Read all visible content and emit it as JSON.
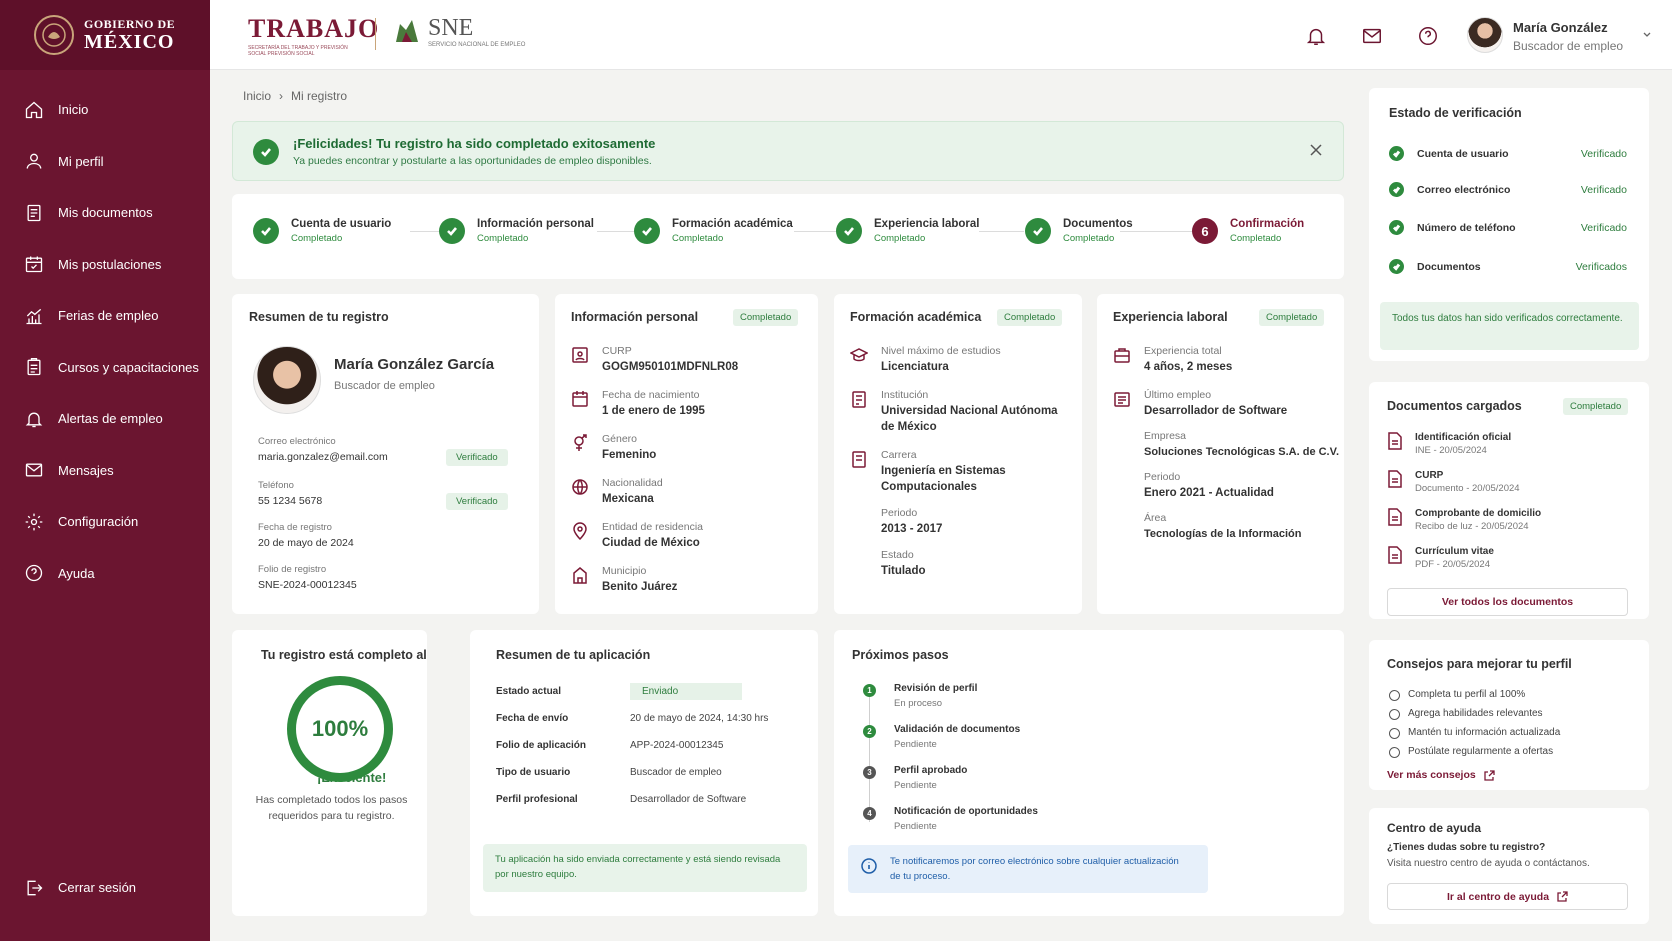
{
  "sidebar": {
    "gob_top": "GOBIERNO DE",
    "gob_main": "MÉXICO",
    "items": [
      {
        "label": "Inicio",
        "icon": "home-icon"
      },
      {
        "label": "Mi perfil",
        "icon": "user-icon"
      },
      {
        "label": "Mis documentos",
        "icon": "document-icon"
      },
      {
        "label": "Mis postulaciones",
        "icon": "calendar-check-icon"
      },
      {
        "label": "Ferias de empleo",
        "icon": "chart-icon"
      },
      {
        "label": "Cursos y capacitaciones",
        "icon": "clipboard-icon"
      },
      {
        "label": "Alertas de empleo",
        "icon": "bell-icon"
      },
      {
        "label": "Mensajes",
        "icon": "mail-icon"
      },
      {
        "label": "Configuración",
        "icon": "gear-icon"
      },
      {
        "label": "Ayuda",
        "icon": "help-icon"
      }
    ],
    "logout": "Cerrar sesión"
  },
  "topbar": {
    "trabajo": "TRABAJO",
    "trabajo_sub": "SECRETARÍA DEL TRABAJO Y PREVISIÓN SOCIAL PREVISIÓN SOCIAL",
    "sne": "SNE",
    "sne_sub": "SERVICIO NACIONAL DE EMPLEO",
    "user_name": "María González",
    "user_role": "Buscador de empleo"
  },
  "breadcrumb": {
    "home": "Inicio",
    "sep": "›",
    "current": "Mi registro"
  },
  "alert": {
    "title": "¡Felicidades! Tu registro ha sido completado exitosamente",
    "text": "Ya puedes encontrar y postularte a las oportunidades de empleo disponibles."
  },
  "steps": [
    {
      "label": "Cuenta de usuario",
      "status": "Completado"
    },
    {
      "label": "Información personal",
      "status": "Completado"
    },
    {
      "label": "Formación académica",
      "status": "Completado"
    },
    {
      "label": "Experiencia laboral",
      "status": "Completado"
    },
    {
      "label": "Documentos",
      "status": "Completado"
    },
    {
      "label": "Confirmación",
      "status": "Completado",
      "num": "6"
    }
  ],
  "resumen": {
    "title": "Resumen de tu registro",
    "name": "María González García",
    "role": "Buscador de empleo",
    "email_label": "Correo electrónico",
    "email": "maria.gonzalez@email.com",
    "email_badge": "Verificado",
    "phone_label": "Teléfono",
    "phone": "55 1234 5678",
    "phone_badge": "Verificado",
    "date_label": "Fecha de registro",
    "date": "20 de mayo de 2024",
    "folio_label": "Folio de registro",
    "folio": "SNE-2024-00012345"
  },
  "personal": {
    "title": "Información personal",
    "badge": "Completado",
    "fields": [
      {
        "label": "CURP",
        "value": "GOGM950101MDFNLR08"
      },
      {
        "label": "Fecha de nacimiento",
        "value": "1 de enero de 1995"
      },
      {
        "label": "Género",
        "value": "Femenino"
      },
      {
        "label": "Nacionalidad",
        "value": "Mexicana"
      },
      {
        "label": "Entidad de residencia",
        "value": "Ciudad de México"
      },
      {
        "label": "Municipio",
        "value": "Benito Juárez"
      }
    ]
  },
  "academica": {
    "title": "Formación académica",
    "badge": "Completado",
    "nivel_label": "Nivel máximo de estudios",
    "nivel": "Licenciatura",
    "inst_label": "Institución",
    "inst": "Universidad Nacional Autónoma de México",
    "carrera_label": "Carrera",
    "carrera": "Ingeniería en Sistemas Computacionales",
    "periodo_label": "Periodo",
    "periodo": "2013 - 2017",
    "estado_label": "Estado",
    "estado": "Titulado"
  },
  "experiencia": {
    "title": "Experiencia laboral",
    "badge": "Completado",
    "total_label": "Experiencia total",
    "total": "4 años, 2 meses",
    "ultimo_label": "Último empleo",
    "ultimo": "Desarrollador de Software",
    "empresa_label": "Empresa",
    "empresa": "Soluciones Tecnológicas S.A. de C.V.",
    "periodo_label": "Periodo",
    "periodo": "Enero 2021 - Actualidad",
    "area_label": "Área",
    "area": "Tecnologías de la Información"
  },
  "completo": {
    "title": "Tu registro está completo al",
    "percent": "100%",
    "progress": 1.0,
    "excellent": "¡Excelente!",
    "text": "Has completado todos los pasos requeridos para tu registro."
  },
  "aplicacion": {
    "title": "Resumen de tu aplicación",
    "rows": [
      {
        "label": "Estado actual",
        "value": "Enviado"
      },
      {
        "label": "Fecha de envío",
        "value": "20 de mayo de 2024, 14:30 hrs"
      },
      {
        "label": "Folio de aplicación",
        "value": "APP-2024-00012345"
      },
      {
        "label": "Tipo de usuario",
        "value": "Buscador de empleo"
      },
      {
        "label": "Perfil profesional",
        "value": "Desarrollador de Software"
      }
    ],
    "note": "Tu aplicación ha sido enviada correctamente y está siendo revisada por nuestro equipo."
  },
  "pasos": {
    "title": "Próximos pasos",
    "items": [
      {
        "num": "1",
        "title": "Revisión de perfil",
        "status": "En proceso"
      },
      {
        "num": "2",
        "title": "Validación de documentos",
        "status": "Pendiente"
      },
      {
        "num": "3",
        "title": "Perfil aprobado",
        "status": "Pendiente"
      },
      {
        "num": "4",
        "title": "Notificación de oportunidades",
        "status": "Pendiente"
      }
    ],
    "note": "Te notificaremos por correo electrónico sobre cualquier actualización de tu proceso."
  },
  "verificacion": {
    "title": "Estado de verificación",
    "rows": [
      {
        "label": "Cuenta de usuario",
        "value": "Verificado"
      },
      {
        "label": "Correo electrónico",
        "value": "Verificado"
      },
      {
        "label": "Número de teléfono",
        "value": "Verificado"
      },
      {
        "label": "Documentos",
        "value": "Verificados"
      }
    ],
    "note": "Todos tus datos han sido verificados correctamente."
  },
  "documentos": {
    "title": "Documentos cargados",
    "badge": "Completado",
    "items": [
      {
        "name": "Identificación oficial",
        "meta": "INE - 20/05/2024"
      },
      {
        "name": "CURP",
        "meta": "Documento - 20/05/2024"
      },
      {
        "name": "Comprobante de domicilio",
        "meta": "Recibo de luz - 20/05/2024"
      },
      {
        "name": "Currículum vitae",
        "meta": "PDF - 20/05/2024"
      }
    ],
    "button": "Ver todos los documentos"
  },
  "consejos": {
    "title": "Consejos para mejorar tu perfil",
    "items": [
      "Completa tu perfil al 100%",
      "Agrega habilidades relevantes",
      "Mantén tu información actualizada",
      "Postúlate regularmente a ofertas"
    ],
    "link": "Ver más consejos"
  },
  "ayuda": {
    "title": "Centro de ayuda",
    "q": "¿Tienes dudas sobre tu registro?",
    "text": "Visita nuestro centro de ayuda o contáctanos.",
    "button": "Ir al centro de ayuda"
  },
  "colors": {
    "brand": "#6b1530",
    "green": "#2e8b3e"
  }
}
